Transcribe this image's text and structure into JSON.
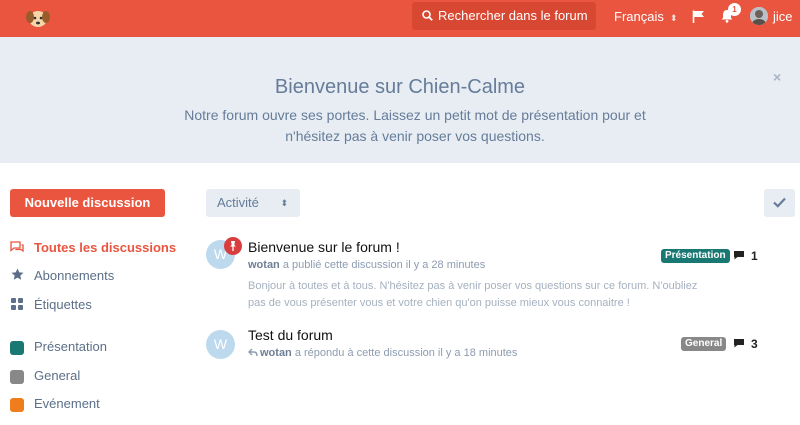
{
  "header": {
    "search_placeholder": "Rechercher dans le forum",
    "language": "Français",
    "notifications_count": "1",
    "username": "jice",
    "brand_color": "#e9553f"
  },
  "hero": {
    "title": "Bienvenue sur Chien-Calme",
    "message": "Notre forum ouvre ses portes. Laissez un petit mot de présentation pour et n'hésitez pas à venir poser vos questions.",
    "close": "×"
  },
  "sidebar": {
    "new_discussion": "Nouvelle discussion",
    "nav": [
      {
        "label": "Toutes les discussions",
        "icon": "comments-icon",
        "active": true
      },
      {
        "label": "Abonnements",
        "icon": "star-icon",
        "active": false
      },
      {
        "label": "Étiquettes",
        "icon": "tags-grid-icon",
        "active": false
      }
    ],
    "tags": [
      {
        "label": "Présentation",
        "color": "#1a7873"
      },
      {
        "label": "General",
        "color": "#888888"
      },
      {
        "label": "Evénement",
        "color": "#f07d1b"
      }
    ]
  },
  "toolbar": {
    "sort": "Activité",
    "mark_read_icon": "check-icon"
  },
  "discussions": [
    {
      "avatar_letter": "W",
      "pinned": true,
      "title": "Bienvenue sur le forum !",
      "author": "wotan",
      "meta": "a publié cette discussion il y a 28 minutes",
      "excerpt": "Bonjour à toutes et à tous. N'hésitez pas à venir poser vos questions sur ce forum. N'oubliez pas de vous présenter vous et votre chien qu'on puisse mieux vous connaitre !",
      "tag": "Présentation",
      "tag_color": "#1a7873",
      "replies": "1"
    },
    {
      "avatar_letter": "W",
      "pinned": false,
      "title": "Test du forum",
      "author": "wotan",
      "meta": "a répondu à cette discussion il y a 18 minutes",
      "excerpt": "",
      "tag": "General",
      "tag_color": "#888888",
      "replies": "3"
    }
  ]
}
